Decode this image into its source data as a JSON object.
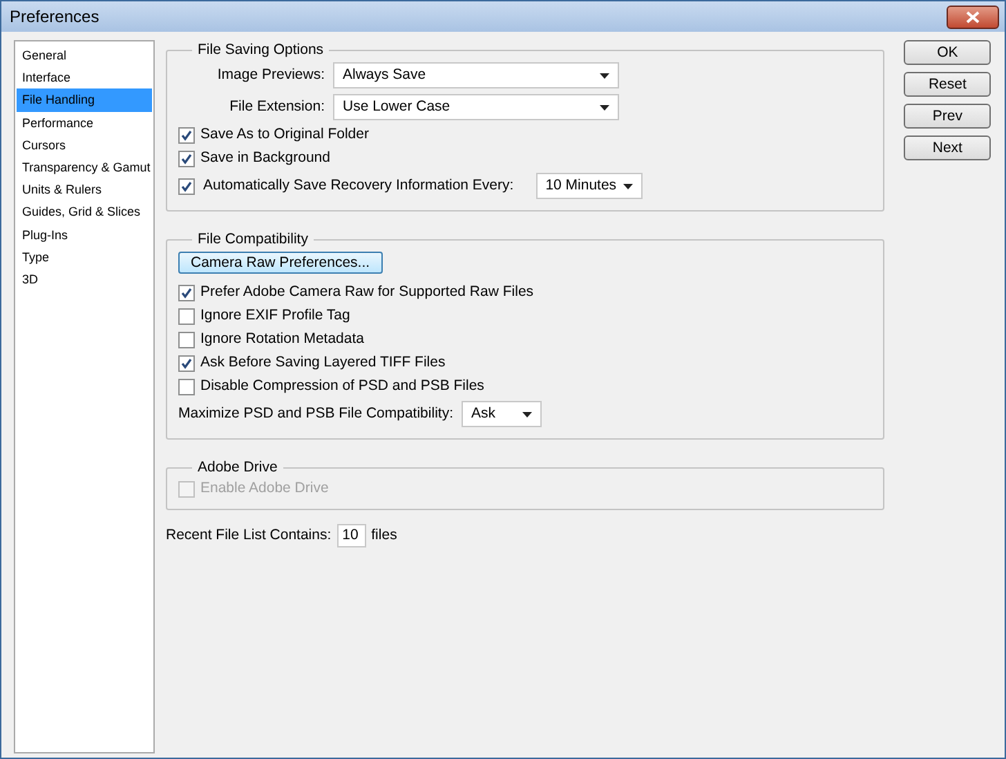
{
  "window": {
    "title": "Preferences"
  },
  "sidebar": {
    "items": [
      {
        "label": "General",
        "selected": false
      },
      {
        "label": "Interface",
        "selected": false
      },
      {
        "label": "File Handling",
        "selected": true
      },
      {
        "label": "Performance",
        "selected": false
      },
      {
        "label": "Cursors",
        "selected": false
      },
      {
        "label": "Transparency & Gamut",
        "selected": false
      },
      {
        "label": "Units & Rulers",
        "selected": false
      },
      {
        "label": "Guides, Grid & Slices",
        "selected": false
      },
      {
        "label": "Plug-Ins",
        "selected": false
      },
      {
        "label": "Type",
        "selected": false
      },
      {
        "label": "3D",
        "selected": false
      }
    ]
  },
  "groups": [
    {
      "title": "File Saving Options",
      "rows": [
        {
          "kind": "select-aligned",
          "label": "Image Previews:",
          "value": "Always Save"
        },
        {
          "kind": "select-aligned",
          "label": "File Extension:",
          "value": "Use Lower Case"
        },
        {
          "kind": "checkbox",
          "label": "Save As to Original Folder",
          "checked": true,
          "disabled": false
        },
        {
          "kind": "checkbox",
          "label": "Save in Background",
          "checked": true,
          "disabled": false
        },
        {
          "kind": "checkbox-select",
          "label": "Automatically Save Recovery Information Every:",
          "checked": true,
          "disabled": false,
          "value": "10 Minutes"
        }
      ]
    },
    {
      "title": "File Compatibility",
      "rows": [
        {
          "kind": "button",
          "label": "Camera Raw Preferences..."
        },
        {
          "kind": "checkbox",
          "label": "Prefer Adobe Camera Raw for Supported Raw Files",
          "checked": true,
          "disabled": false
        },
        {
          "kind": "checkbox",
          "label": "Ignore EXIF Profile Tag",
          "checked": false,
          "disabled": false
        },
        {
          "kind": "checkbox",
          "label": "Ignore Rotation Metadata",
          "checked": false,
          "disabled": false
        },
        {
          "kind": "checkbox",
          "label": "Ask Before Saving Layered TIFF Files",
          "checked": true,
          "disabled": false
        },
        {
          "kind": "checkbox",
          "label": "Disable Compression of PSD and PSB Files",
          "checked": false,
          "disabled": false
        },
        {
          "kind": "select",
          "label": "Maximize PSD and PSB File Compatibility:",
          "value": "Ask"
        }
      ]
    },
    {
      "title": "Adobe Drive",
      "rows": [
        {
          "kind": "checkbox",
          "label": "Enable Adobe Drive",
          "checked": false,
          "disabled": true
        }
      ]
    }
  ],
  "recent_files": {
    "label": "Recent File List Contains:",
    "value": "10",
    "suffix": "files"
  },
  "buttons": [
    "OK",
    "Reset",
    "Prev",
    "Next"
  ]
}
